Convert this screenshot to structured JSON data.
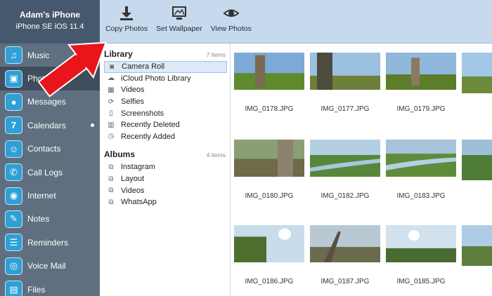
{
  "device": {
    "name": "Adam's iPhone",
    "model": "iPhone SE iOS 11.4"
  },
  "toolbar": {
    "buttons": [
      {
        "label": "Copy Photos",
        "icon": "download-icon"
      },
      {
        "label": "Set Wallpaper",
        "icon": "wallpaper-icon"
      },
      {
        "label": "View Photos",
        "icon": "eye-icon"
      }
    ]
  },
  "sidebar": {
    "items": [
      {
        "label": "Music",
        "icon": "music-icon"
      },
      {
        "label": "Photos",
        "icon": "photos-icon"
      },
      {
        "label": "Messages",
        "icon": "messages-icon"
      },
      {
        "label": "Calendars",
        "icon": "calendar-icon",
        "glyph": "7"
      },
      {
        "label": "Contacts",
        "icon": "contacts-icon"
      },
      {
        "label": "Call Logs",
        "icon": "phone-icon"
      },
      {
        "label": "Internet",
        "icon": "internet-icon"
      },
      {
        "label": "Notes",
        "icon": "notes-icon"
      },
      {
        "label": "Reminders",
        "icon": "reminders-icon"
      },
      {
        "label": "Voice Mail",
        "icon": "voicemail-icon"
      },
      {
        "label": "Files",
        "icon": "files-icon"
      }
    ]
  },
  "library": {
    "title": "Library",
    "count": "7 items",
    "items": [
      {
        "label": "Camera Roll",
        "icon": "camera-icon"
      },
      {
        "label": "iCloud Photo Library",
        "icon": "cloud-icon"
      },
      {
        "label": "Videos",
        "icon": "film-icon"
      },
      {
        "label": "Selfies",
        "icon": "selfie-icon"
      },
      {
        "label": "Screenshots",
        "icon": "screenshot-icon"
      },
      {
        "label": "Recently Deleted",
        "icon": "trash-icon"
      },
      {
        "label": "Recently Added",
        "icon": "clock-icon"
      }
    ]
  },
  "albums": {
    "title": "Albums",
    "count": "4 items",
    "items": [
      {
        "label": "Instagram",
        "icon": "album-icon"
      },
      {
        "label": "Layout",
        "icon": "album-icon"
      },
      {
        "label": "Videos",
        "icon": "album-icon"
      },
      {
        "label": "WhatsApp",
        "icon": "album-icon"
      }
    ]
  },
  "photos": [
    {
      "name": "IMG_0178.JPG",
      "sky": "#7da9d6",
      "ground": "#5f8a2e"
    },
    {
      "name": "IMG_0177.JPG",
      "sky": "#9cc0e0",
      "ground": "#6d7f3a"
    },
    {
      "name": "IMG_0179.JPG",
      "sky": "#8fb7dc",
      "ground": "#5c7d2a"
    },
    {
      "name": "",
      "sky": "#a3c7e6",
      "ground": "#6b8b3b"
    },
    {
      "name": "IMG_0180.JPG",
      "sky": "#8aa072",
      "ground": "#6e6a4a"
    },
    {
      "name": "IMG_0182.JPG",
      "sky": "#b4cfe2",
      "ground": "#55883a"
    },
    {
      "name": "IMG_0183.JPG",
      "sky": "#a7c3dc",
      "ground": "#5d8d3b"
    },
    {
      "name": "",
      "sky": "#9ebfd8",
      "ground": "#4f7d35"
    },
    {
      "name": "IMG_0186.JPG",
      "sky": "#c8dceb",
      "ground": "#4d6e2e"
    },
    {
      "name": "IMG_0187.JPG",
      "sky": "#b9c9d3",
      "ground": "#6a6a4e"
    },
    {
      "name": "IMG_0185.JPG",
      "sky": "#d1e2ee",
      "ground": "#4a6c33"
    },
    {
      "name": "",
      "sky": "#aecde5",
      "ground": "#5e7d3c"
    }
  ],
  "colors": {
    "arrow": "#e8161b",
    "accent": "#2f9fd6"
  }
}
